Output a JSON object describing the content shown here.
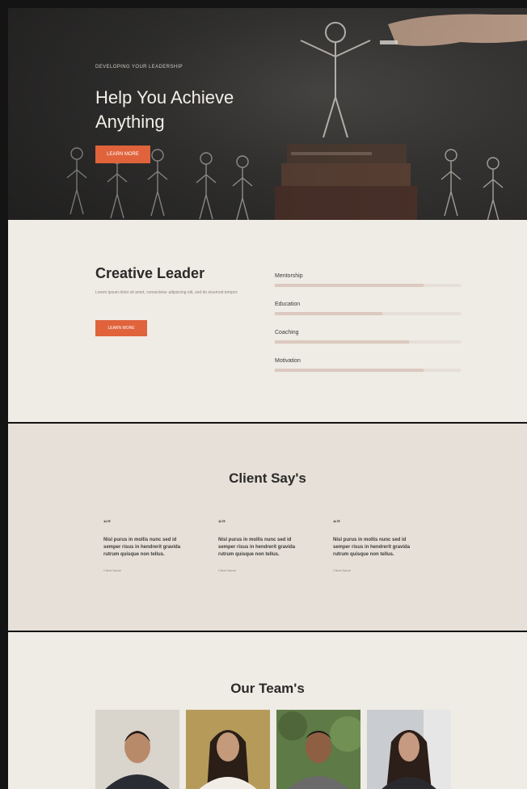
{
  "hero": {
    "kicker": "DEVELOPING YOUR LEADERSHIP",
    "title": "Help You Achieve Anything",
    "button_label": "LEARN MORE"
  },
  "leader": {
    "title": "Creative Leader",
    "text": "Lorem ipsum dolor sit amet, consectetur adipiscing elit, sed do eiusmod tempor.",
    "button_label": "LEARN MORE",
    "skills": [
      {
        "label": "Mentorship",
        "level": 0.8
      },
      {
        "label": "Education",
        "level": 0.58
      },
      {
        "label": "Coaching",
        "level": 0.72
      },
      {
        "label": "Motivation",
        "level": 0.8
      }
    ]
  },
  "clients": {
    "title": "Client Say's",
    "quotes": [
      {
        "icon": "“”",
        "text": "Nisl purus in mollis nunc sed id semper risus in hendrerit gravida rutrum quisque non tellus.",
        "name": "Client Name"
      },
      {
        "icon": "“”",
        "text": "Nisl purus in mollis nunc sed id semper risus in hendrerit gravida rutrum quisque non tellus.",
        "name": "Client Name"
      },
      {
        "icon": "“”",
        "text": "Nisl purus in mollis nunc sed id semper risus in hendrerit gravida rutrum quisque non tellus.",
        "name": "Client Name"
      }
    ]
  },
  "team": {
    "title": "Our Team's",
    "members": [
      {
        "photo": "team-member-1-photo",
        "bg": "#d9d4cc",
        "shirt": "#2a2c33",
        "skin": "#b88a6a"
      },
      {
        "photo": "team-member-2-photo",
        "bg": "#b59a5a",
        "shirt": "#f1ede6",
        "skin": "#c49a7a"
      },
      {
        "photo": "team-member-3-photo",
        "bg": "#5e7a46",
        "shirt": "#6a6a6a",
        "skin": "#8f5f44"
      },
      {
        "photo": "team-member-4-photo",
        "bg": "#c9ccd0",
        "shirt": "#2a2a2e",
        "skin": "#c59a80"
      }
    ]
  },
  "colors": {
    "accent": "#e0633c",
    "hero_bg": "#353433",
    "section_light": "#efebe5",
    "section_beige": "#e6e0d8"
  }
}
